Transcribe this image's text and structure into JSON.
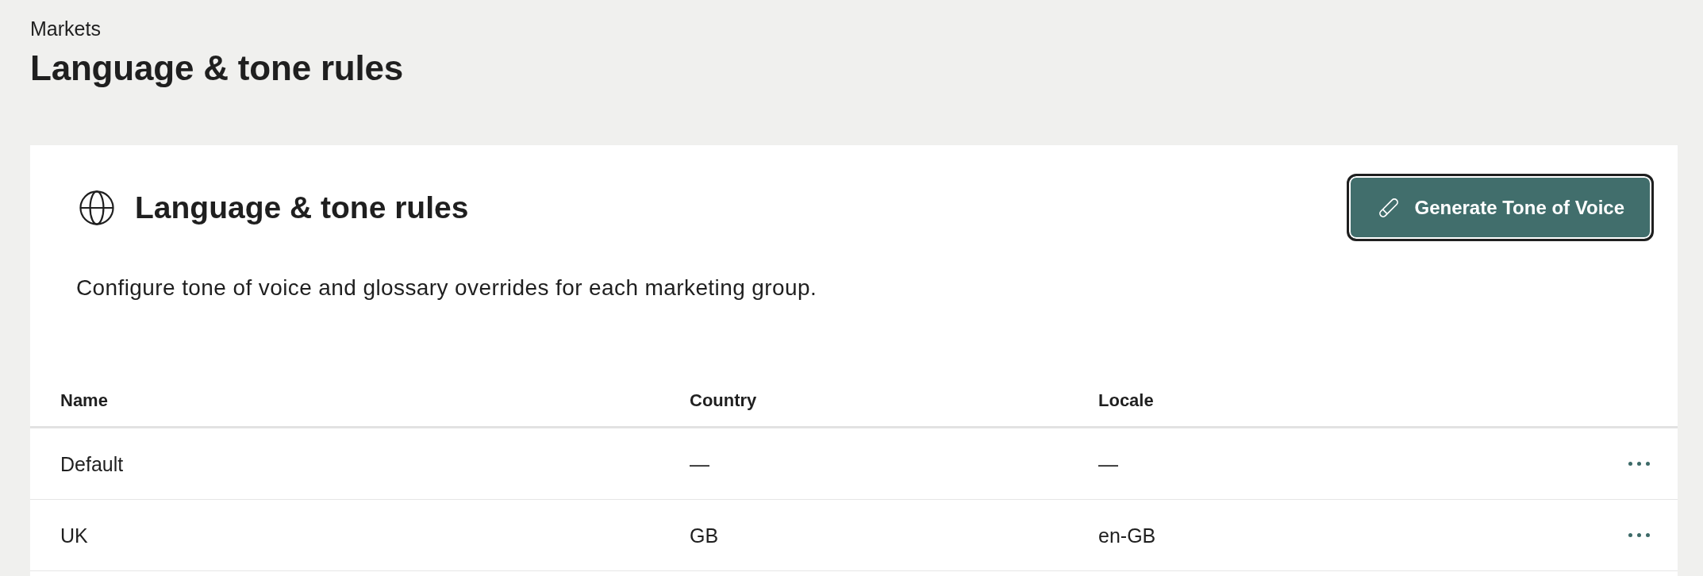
{
  "breadcrumb": "Markets",
  "page_title": "Language & tone rules",
  "card": {
    "title": "Language & tone rules",
    "description": "Configure tone of voice and glossary overrides for each marketing group.",
    "action_button": {
      "label": "Generate Tone of Voice",
      "focused": true
    }
  },
  "table": {
    "columns": [
      "Name",
      "Country",
      "Locale"
    ],
    "rows": [
      {
        "cells": [
          "Default",
          "—",
          "—"
        ]
      },
      {
        "cells": [
          "UK",
          "GB",
          "en-GB"
        ]
      }
    ]
  }
}
